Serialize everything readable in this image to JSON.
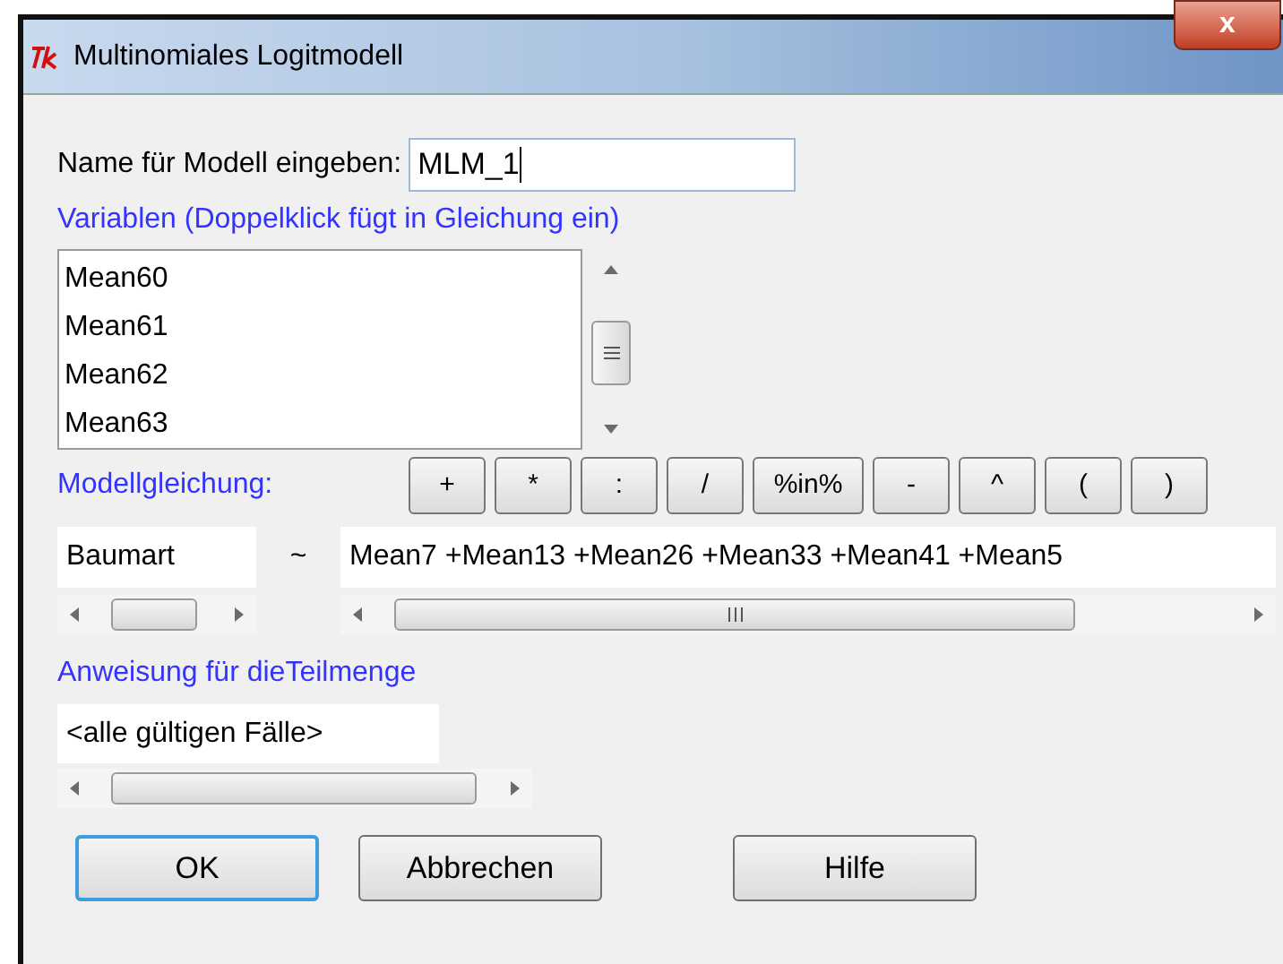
{
  "window": {
    "title": "Multinomiales Logitmodell",
    "close": "x"
  },
  "model_name": {
    "label": "Name für Modell eingeben:",
    "value": "MLM_1"
  },
  "variables": {
    "label": "Variablen (Doppelklick fügt in Gleichung ein)",
    "items": [
      "Mean60",
      "Mean61",
      "Mean62",
      "Mean63"
    ]
  },
  "equation": {
    "label": "Modellgleichung:",
    "operators": [
      "+",
      "*",
      ":",
      "/",
      "%in%",
      "-",
      "^",
      "(",
      ")"
    ],
    "lhs": "Baumart",
    "tilde": "~",
    "rhs": "Mean7 +Mean13 +Mean26 +Mean33 +Mean41 +Mean5"
  },
  "subset": {
    "label": "Anweisung für dieTeilmenge",
    "value": "<alle gültigen Fälle>"
  },
  "buttons": [
    {
      "label": "OK",
      "focused": true
    },
    {
      "label": "Abbrechen",
      "focused": false
    },
    {
      "label": "Hilfe",
      "focused": false
    }
  ]
}
